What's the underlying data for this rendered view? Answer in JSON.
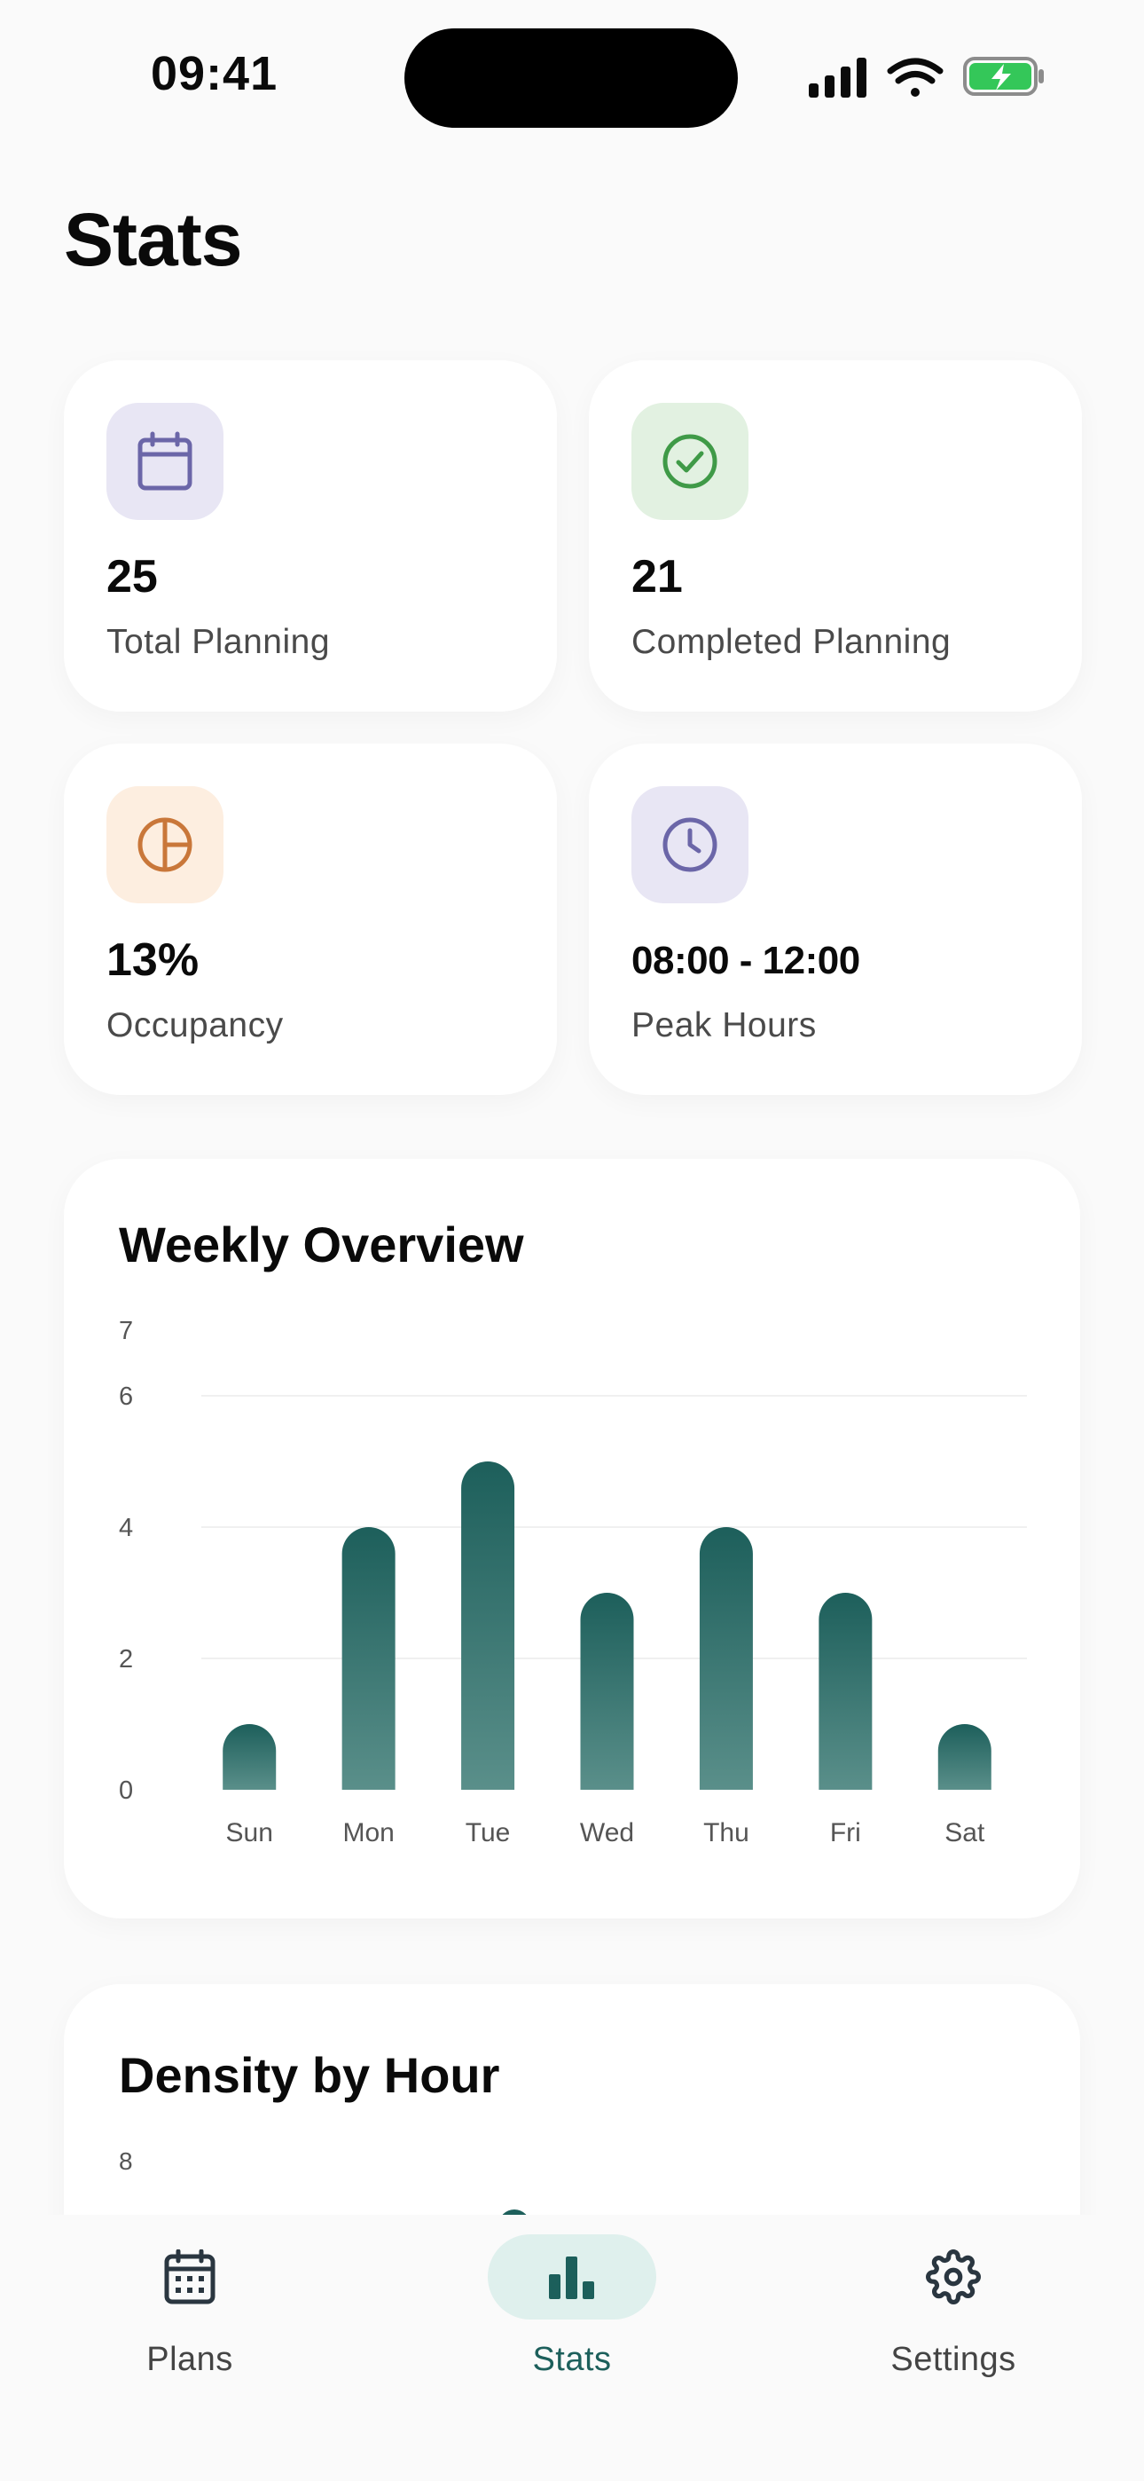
{
  "status_bar": {
    "time": "09:41"
  },
  "page": {
    "title": "Stats"
  },
  "stats": [
    {
      "value": "25",
      "label": "Total Planning",
      "icon": "calendar-icon"
    },
    {
      "value": "21",
      "label": "Completed Planning",
      "icon": "check-circle-icon"
    },
    {
      "value": "13%",
      "label": "Occupancy",
      "icon": "pie-chart-icon"
    },
    {
      "value": "08:00 - 12:00",
      "label": "Peak Hours",
      "icon": "clock-icon"
    }
  ],
  "weekly": {
    "title": "Weekly Overview",
    "chart_data": {
      "type": "bar",
      "categories": [
        "Sun",
        "Mon",
        "Tue",
        "Wed",
        "Thu",
        "Fri",
        "Sat"
      ],
      "values": [
        1,
        4,
        5,
        3,
        4,
        3,
        1
      ],
      "y_ticks": [
        "0",
        "2",
        "4",
        "6",
        "7"
      ],
      "ylim": [
        0,
        7
      ],
      "grid": true
    }
  },
  "density": {
    "title": "Density by Hour",
    "chart_data": {
      "type": "bar",
      "y_ticks": [
        "8"
      ]
    }
  },
  "tabs": [
    {
      "label": "Plans",
      "icon": "calendar-icon",
      "active": false
    },
    {
      "label": "Stats",
      "icon": "bar-chart-icon",
      "active": true
    },
    {
      "label": "Settings",
      "icon": "gear-icon",
      "active": false
    }
  ],
  "colors": {
    "accent": "#1c5f5b",
    "calendar_bg": "#e8e6f4",
    "calendar_fg": "#6b66a8",
    "check_bg": "#e2f1e1",
    "check_fg": "#3f9a47",
    "pie_bg": "#fdeee0",
    "pie_fg": "#c9773a",
    "clock_bg": "#e8e6f4",
    "clock_fg": "#6b66a8"
  }
}
